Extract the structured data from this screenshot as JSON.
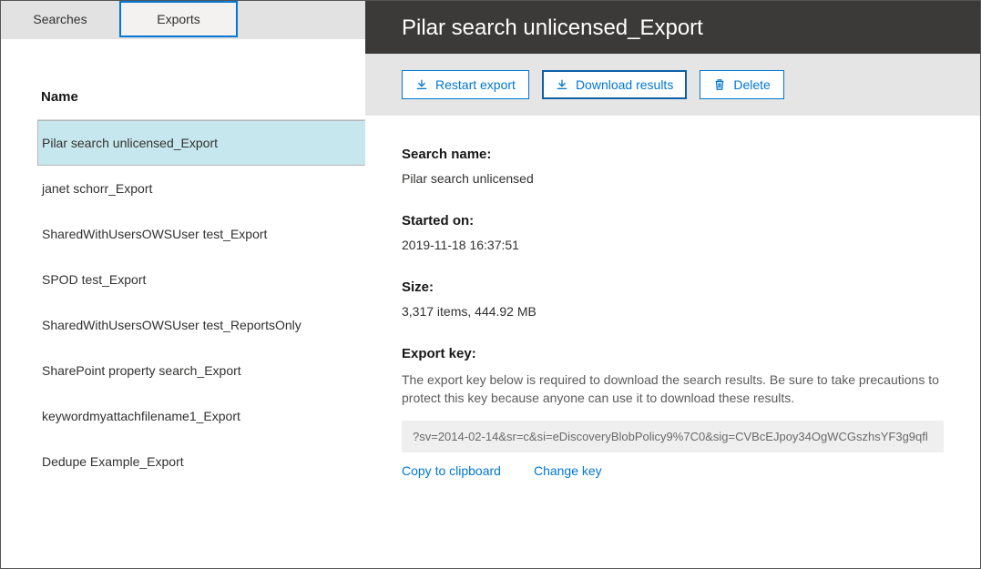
{
  "tabs": {
    "searches": "Searches",
    "exports": "Exports"
  },
  "list": {
    "header": "Name",
    "items": [
      "Pilar search unlicensed_Export",
      "janet schorr_Export",
      "SharedWithUsersOWSUser test_Export",
      "SPOD test_Export",
      "SharedWithUsersOWSUser test_ReportsOnly",
      "SharePoint property search_Export",
      "keywordmyattachfilename1_Export",
      "Dedupe Example_Export"
    ]
  },
  "detail": {
    "title": "Pilar search unlicensed_Export",
    "toolbar": {
      "restart": "Restart export",
      "download": "Download results",
      "delete": "Delete"
    },
    "search_name_label": "Search name:",
    "search_name_value": "Pilar search unlicensed",
    "started_label": "Started on:",
    "started_value": "2019-11-18 16:37:51",
    "size_label": "Size:",
    "size_value": "3,317 items, 444.92 MB",
    "exportkey_label": "Export key:",
    "exportkey_hint": "The export key below is required to download the search results. Be sure to take precautions to protect this key because anyone can use it to download these results.",
    "exportkey_value": "?sv=2014-02-14&sr=c&si=eDiscoveryBlobPolicy9%7C0&sig=CVBcEJpoy34OgWCGszhsYF3g9qfl",
    "copy": "Copy to clipboard",
    "change": "Change key"
  }
}
